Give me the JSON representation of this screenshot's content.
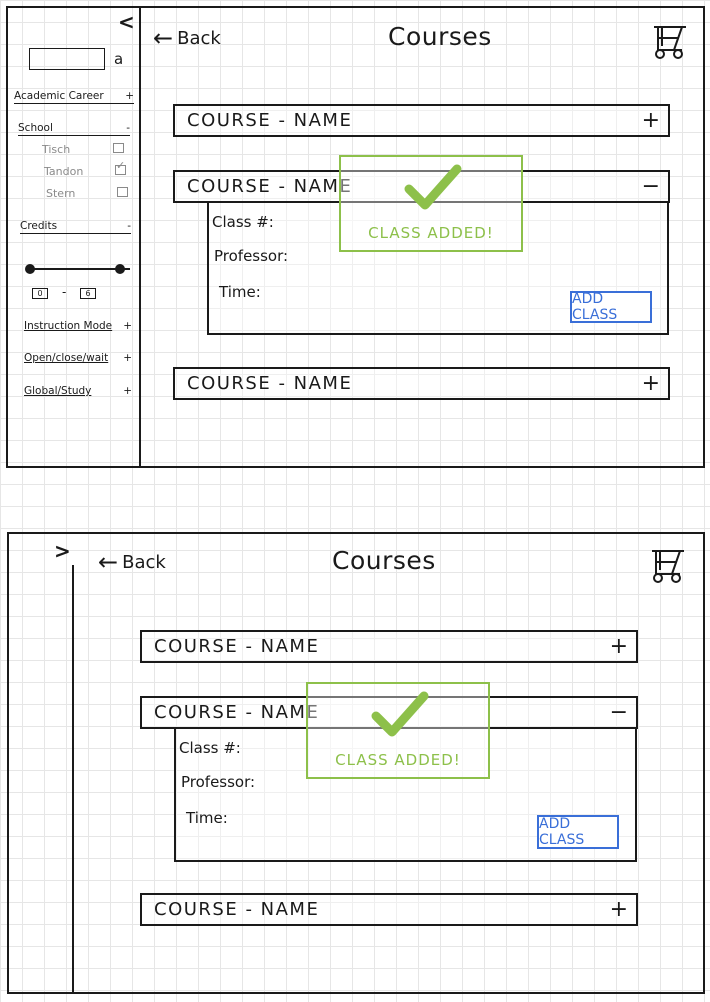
{
  "top": {
    "collapse_toggle": "<",
    "back_label": "Back",
    "title": "Courses",
    "search_glyph": "a",
    "filters": {
      "academic_career": {
        "label": "Academic Career",
        "sign": "+"
      },
      "school": {
        "label": "School",
        "sign": "-"
      },
      "school_options": [
        {
          "label": "Tisch",
          "checked": false
        },
        {
          "label": "Tandon",
          "checked": true
        },
        {
          "label": "Stern",
          "checked": false
        }
      ],
      "credits": {
        "label": "Credits",
        "sign": "-"
      },
      "credit_min": "0",
      "credit_separator": "-",
      "credit_max": "6",
      "instruction_mode": {
        "label": "Instruction Mode",
        "sign": "+"
      },
      "open_close_wait": {
        "label": "Open/close/wait",
        "sign": "+"
      },
      "global_study": {
        "label": "Global/Study",
        "sign": "+"
      }
    },
    "courses": [
      {
        "name": "COURSE - NAME",
        "sign": "+"
      },
      {
        "name": "COURSE - NAME",
        "sign": "−"
      },
      {
        "name": "COURSE - NAME",
        "sign": "+"
      }
    ],
    "details": {
      "class_label": "Class #:",
      "professor_label": "Professor:",
      "time_label": "Time:",
      "add_button": "ADD CLASS"
    },
    "toast": "CLASS ADDED!"
  },
  "bottom": {
    "expand_toggle": ">",
    "back_label": "Back",
    "title": "Courses",
    "courses": [
      {
        "name": "COURSE - NAME",
        "sign": "+"
      },
      {
        "name": "COURSE - NAME",
        "sign": "−"
      },
      {
        "name": "COURSE - NAME",
        "sign": "+"
      }
    ],
    "details": {
      "class_label": "Class #:",
      "professor_label": "Professor:",
      "time_label": "Time:",
      "add_button": "ADD CLASS"
    },
    "toast": "CLASS ADDED!"
  },
  "icons": {
    "cart": "cart-icon",
    "check": "checkmark-icon",
    "back_arrow": "back-arrow-icon",
    "search": "search-icon"
  },
  "colors": {
    "toast_green": "#8dc04a",
    "button_blue": "#3a6fd8",
    "checkbox_gray": "#8a8a8a"
  }
}
